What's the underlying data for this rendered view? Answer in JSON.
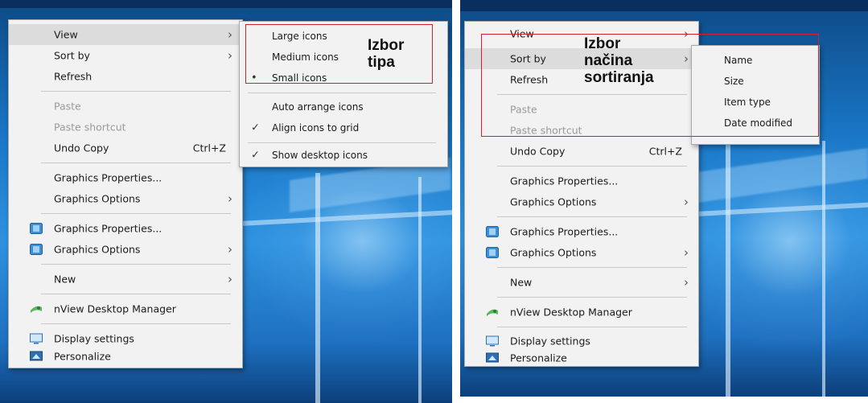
{
  "left_menu": {
    "view": "View",
    "sort_by": "Sort by",
    "refresh": "Refresh",
    "paste": "Paste",
    "paste_shortcut": "Paste shortcut",
    "undo_copy": "Undo Copy",
    "undo_shortcut": "Ctrl+Z",
    "graphics_properties_1": "Graphics Properties...",
    "graphics_options_1": "Graphics Options",
    "graphics_properties_2": "Graphics Properties...",
    "graphics_options_2": "Graphics Options",
    "new": "New",
    "nview": "nView Desktop Manager",
    "display_settings": "Display settings",
    "personalize": "Personalize"
  },
  "view_submenu": {
    "large_icons": "Large icons",
    "medium_icons": "Medium icons",
    "small_icons": "Small icons",
    "auto_arrange": "Auto arrange icons",
    "align_to_grid": "Align icons to grid",
    "show_desktop_icons": "Show desktop icons",
    "selected_bullet": "•",
    "check": "✓"
  },
  "annotation_left": {
    "line1": "Izbor",
    "line2": "tipa"
  },
  "right_menu": {
    "view": "View",
    "sort_by": "Sort by",
    "refresh": "Refresh",
    "paste": "Paste",
    "paste_shortcut": "Paste shortcut",
    "undo_copy": "Undo Copy",
    "undo_shortcut": "Ctrl+Z",
    "graphics_properties_1": "Graphics Properties...",
    "graphics_options_1": "Graphics Options",
    "graphics_properties_2": "Graphics Properties...",
    "graphics_options_2": "Graphics Options",
    "new": "New",
    "nview": "nView Desktop Manager",
    "display_settings": "Display settings",
    "personalize": "Personalize"
  },
  "sort_submenu": {
    "name": "Name",
    "size": "Size",
    "item_type": "Item type",
    "date_modified": "Date modified"
  },
  "annotation_right": {
    "line1": "Izbor",
    "line2": "načina",
    "line3": "sortiranja"
  },
  "icons": {
    "chevron": "›",
    "graphics_icon": "graphics-icon",
    "nview_icon": "nview-icon",
    "display_icon": "display-icon",
    "personalize_icon": "personalize-icon"
  },
  "colors": {
    "menu_bg": "#f2f2f2",
    "highlight": "#dcdcdc",
    "annotation_border": "#d21f2b",
    "desktop_blue": "#1a78c8"
  }
}
